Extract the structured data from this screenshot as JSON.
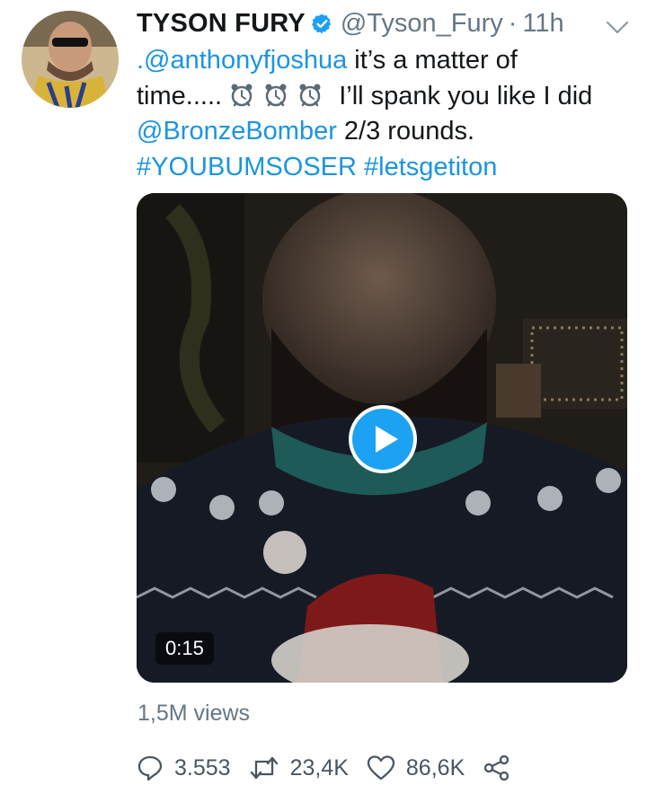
{
  "tweet": {
    "author_name": "TYSON FURY",
    "handle": "@Tyson_Fury",
    "separator": "·",
    "time": "11h",
    "line1_mention": ".@anthonyfjoshua",
    "line1_rest": " it’s a matter of",
    "line2_start": "time.....",
    "line2_end": " I’ll spank you like I did",
    "line3_mention": "@BronzeBomber",
    "line3_rest": " 2/3 rounds.",
    "hashtag1": "#YOUBUMSOSER",
    "hashtag2": "#letsgetiton"
  },
  "video": {
    "duration": "0:15",
    "views": "1,5M views"
  },
  "actions": {
    "replies": "3.553",
    "retweets": "23,4K",
    "likes": "86,6K"
  },
  "colors": {
    "link": "#1b95e0",
    "secondary_text": "#657786",
    "play_button": "#1da1f2"
  },
  "icons": [
    "verified-icon",
    "chevron-down-icon",
    "alarm-clock-icon",
    "play-icon",
    "reply-icon",
    "retweet-icon",
    "like-icon",
    "share-icon"
  ]
}
